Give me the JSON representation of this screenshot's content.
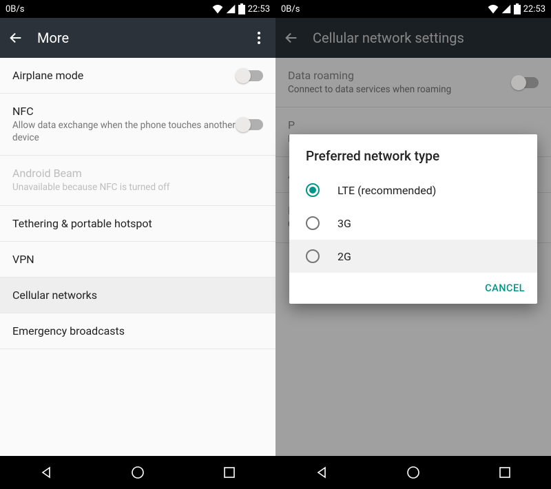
{
  "status": {
    "speed": "0B/s",
    "time": "22:53"
  },
  "left": {
    "title": "More",
    "rows": [
      {
        "title": "Airplane mode",
        "sub": "",
        "toggle": true
      },
      {
        "title": "NFC",
        "sub": "Allow data exchange when the phone touches another device",
        "toggle": true
      },
      {
        "title": "Android Beam",
        "sub": "Unavailable because NFC is turned off",
        "disabled": true
      },
      {
        "title": "Tethering & portable hotspot"
      },
      {
        "title": "VPN"
      },
      {
        "title": "Cellular networks",
        "selected": true
      },
      {
        "title": "Emergency broadcasts"
      }
    ]
  },
  "right": {
    "title": "Cellular network settings",
    "rows": [
      {
        "title": "Data roaming",
        "sub": "Connect to data services when roaming",
        "toggle": true
      },
      {
        "title": "P",
        "sub": "L"
      },
      {
        "title": "A"
      },
      {
        "title": "N",
        "sub": "C"
      }
    ],
    "dialog": {
      "title": "Preferred network type",
      "options": [
        {
          "label": "LTE (recommended)",
          "checked": true
        },
        {
          "label": "3G",
          "checked": false
        },
        {
          "label": "2G",
          "checked": false
        }
      ],
      "cancel": "CANCEL"
    }
  }
}
